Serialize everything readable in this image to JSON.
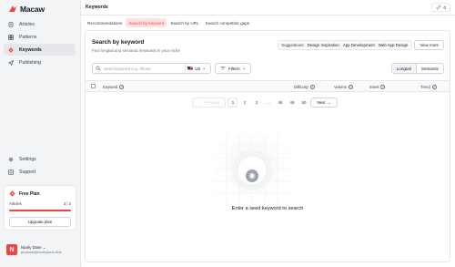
{
  "brand": {
    "name": "Macaw"
  },
  "sidebar": {
    "items": [
      {
        "label": "Articles",
        "icon": "doc-icon",
        "active": false
      },
      {
        "label": "Patterns",
        "icon": "grid-icon",
        "active": false
      },
      {
        "label": "Keywords",
        "icon": "pen-nib-icon",
        "active": true
      },
      {
        "label": "Publishing",
        "icon": "send-icon",
        "active": false
      }
    ],
    "bottom_items": [
      {
        "label": "Settings",
        "icon": "gear-icon"
      },
      {
        "label": "Support",
        "icon": "support-icon"
      }
    ]
  },
  "plan": {
    "title": "Free Plan",
    "articles_label": "Articles",
    "articles_count": "3 / 3",
    "usage_fraction": 1.0,
    "upgrade_label": "Upgrade plan"
  },
  "user": {
    "initial": "N",
    "name": "Nicely Done",
    "email": "products@nicelydone.club"
  },
  "header": {
    "title": "Keywords",
    "credits": "0"
  },
  "tabs": [
    {
      "label": "Recommendations",
      "active": false
    },
    {
      "label": "Search by keyword",
      "active": true
    },
    {
      "label": "Search by URL",
      "active": false
    },
    {
      "label": "Search competitor gaps",
      "active": false
    }
  ],
  "search_section": {
    "title": "Search by keyword",
    "subtitle": "Find longtail and semantic keywords in your niche",
    "suggestions_label": "Suggestions:",
    "suggestions": [
      "Design Inspiration",
      "App Development",
      "Web App Design"
    ],
    "view_more": "View more",
    "placeholder": "Seed keyword e.g. shoes",
    "country": "US",
    "filters_label": "Filters",
    "toggle": [
      {
        "label": "Longtail",
        "active": true
      },
      {
        "label": "Semantic",
        "active": false
      }
    ]
  },
  "table": {
    "columns": [
      "Keyword",
      "Difficulty",
      "Volume",
      "Intent",
      "Trend"
    ]
  },
  "pagination": {
    "previous": "Previous",
    "pages": [
      "1",
      "2",
      "3",
      "...",
      "48",
      "49",
      "50"
    ],
    "current": "1",
    "next": "Next"
  },
  "empty_state": {
    "message": "Enter a seed keyword to search"
  },
  "colors": {
    "accent": "#ef4444",
    "accent_light": "#fee2e2"
  }
}
